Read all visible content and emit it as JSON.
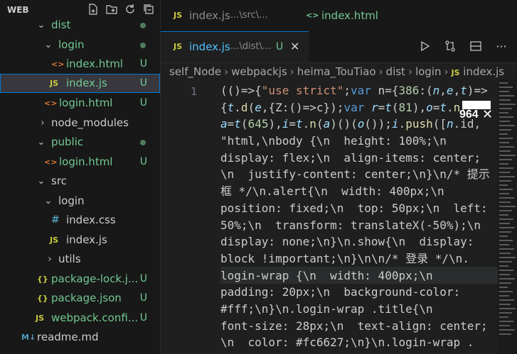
{
  "explorer": {
    "title": "WEB",
    "actions": [
      "new-file-icon",
      "new-folder-icon",
      "refresh-icon",
      "collapse-all-icon"
    ],
    "items": [
      {
        "label": "dist",
        "status": "",
        "type": "folder-open"
      },
      {
        "label": "login",
        "status": "",
        "type": "folder-open"
      },
      {
        "label": "index.html",
        "status": "U",
        "type": "html"
      },
      {
        "label": "index.js",
        "status": "U",
        "type": "js"
      },
      {
        "label": "login.html",
        "status": "U",
        "type": "html"
      },
      {
        "label": "node_modules",
        "status": "",
        "type": "folder-closed"
      },
      {
        "label": "public",
        "status": "",
        "type": "folder-open"
      },
      {
        "label": "login.html",
        "status": "U",
        "type": "html"
      },
      {
        "label": "src",
        "status": "",
        "type": "folder-open"
      },
      {
        "label": "login",
        "status": "",
        "type": "folder-open"
      },
      {
        "label": "index.css",
        "status": "",
        "type": "css"
      },
      {
        "label": "index.js",
        "status": "",
        "type": "js"
      },
      {
        "label": "utils",
        "status": "",
        "type": "folder-closed"
      },
      {
        "label": "package-lock.j...",
        "status": "U",
        "type": "json"
      },
      {
        "label": "package.json",
        "status": "U",
        "type": "json"
      },
      {
        "label": "webpack.confi...",
        "status": "U",
        "type": "js"
      },
      {
        "label": "readme.md",
        "status": "",
        "type": "md"
      }
    ]
  },
  "tabs": {
    "tab1": {
      "icon": "JS",
      "label": "index.js",
      "sub": "...\\src\\..."
    },
    "tab2": {
      "icon": "<>",
      "label": "index.html"
    },
    "active": {
      "icon": "JS",
      "label": "index.js",
      "sub": "...\\dist\\...",
      "status": "U",
      "close": "✕"
    }
  },
  "editor_actions": [
    "run-icon",
    "compare-changes-icon",
    "split-editor-icon",
    "more-actions-icon"
  ],
  "breadcrumb": [
    "self_Node",
    "webpackjs",
    "heima_TouTiao",
    "dist",
    "login",
    "index.js"
  ],
  "breadcrumb_icon": "JS",
  "line_number": "1",
  "badge": {
    "text": "964",
    "close": "✕"
  },
  "code_lines": [
    "(()=>{\"use strict\";var n={386:(n,e,t)=>",
    "{t.d(e,{Z:()=>c});var r=t(81),o=t.n(r",
    "a=t(645),i=t.n(a)()(o());i.push([n.id,",
    "\"html,\\nbody {\\n  height: 100%;\\n",
    "display: flex;\\n  align-items: center;",
    "\\n  justify-content: center;\\n}\\n/* 提示",
    "框 */\\n.alert{\\n  width: 400px;\\n",
    "position: fixed;\\n  top: 50px;\\n  left:",
    "50%;\\n  transform: translateX(-50%);\\n",
    "display: none;\\n}\\n.show{\\n  display:",
    "block !important;\\n}\\n\\n/* 登录 */\\n.",
    "login-wrap {\\n  width: 400px;\\n",
    "padding: 20px;\\n  background-color:",
    "#fff;\\n}\\n.login-wrap .title{\\n",
    "font-size: 28px;\\n  text-align: center;",
    "\\n  color: #fc6627;\\n}\\n.login-wrap ."
  ]
}
